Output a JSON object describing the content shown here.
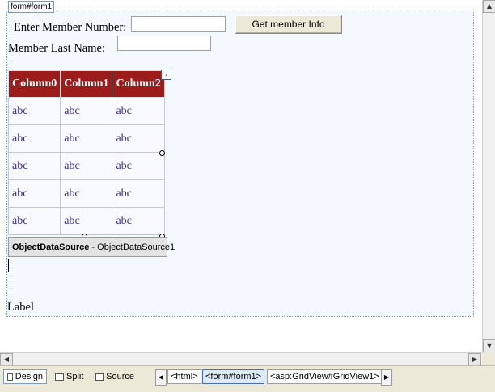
{
  "form": {
    "tag_label": "form#form1",
    "member_number_label": "Enter Member Number:",
    "member_number_value": "",
    "member_last_name_label": "Member Last Name:",
    "member_last_name_value": "",
    "get_info_button": "Get member Info"
  },
  "grid": {
    "columns": [
      "Column0",
      "Column1",
      "Column2"
    ],
    "rows": [
      [
        "abc",
        "abc",
        "abc"
      ],
      [
        "abc",
        "abc",
        "abc"
      ],
      [
        "abc",
        "abc",
        "abc"
      ],
      [
        "abc",
        "abc",
        "abc"
      ],
      [
        "abc",
        "abc",
        "abc"
      ]
    ],
    "smart_tag_glyph": "›",
    "header_color": "#9c1c1c",
    "cell_text_color": "#3b2c9a"
  },
  "datasource": {
    "type": "ObjectDataSource",
    "separator": " - ",
    "id": "ObjectDataSource1"
  },
  "label_control": "Label",
  "bottom_bar": {
    "tabs": [
      {
        "label": "Design",
        "active": true
      },
      {
        "label": "Split",
        "active": false
      },
      {
        "label": "Source",
        "active": false
      }
    ],
    "breadcrumbs": [
      "<html>",
      "<form#form1>",
      "<asp:GridView#GridView1>"
    ]
  },
  "icons": {
    "scroll_up": "▲",
    "scroll_down": "▼",
    "scroll_left": "◀",
    "scroll_right": "▶",
    "nav_left": "◀",
    "nav_right": "▶"
  }
}
